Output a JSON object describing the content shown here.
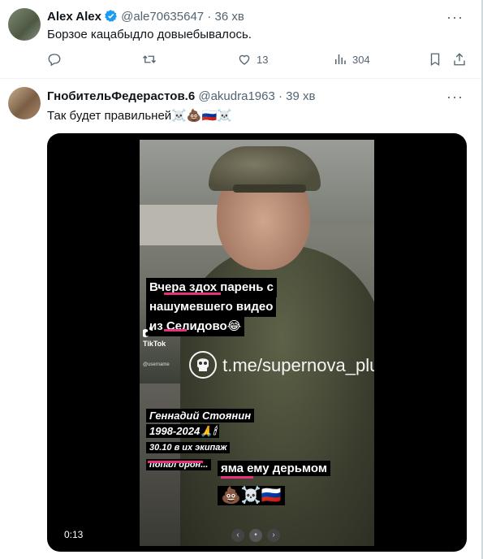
{
  "tweets": [
    {
      "author": "Alex Alex",
      "verified": true,
      "handle": "@ale70635647",
      "time": "36 хв",
      "text": "Борзое кацабыдло  довыебывалось.",
      "actions": {
        "reply": "",
        "retweet": "",
        "likes": "13",
        "views": "304"
      }
    },
    {
      "author": "ГнобительФедерастов.6",
      "handle": "@akudra1963",
      "time": "39 хв",
      "text": "Так будет правильней☠️💩🇷🇺☠️",
      "video": {
        "caption1_line1": "Вчера здох парень с",
        "caption1_line2": "нашумевшего видео",
        "caption1_line3": "из Селидово😂",
        "tiktok_label": "TikTok",
        "tiktok_user": "@username",
        "watermark": "t.me/supernova_plus",
        "caption2_line1": "Геннадий Стоянин",
        "caption2_line2": "1998-2024🙏🕯",
        "caption2_line3": "30.10 в их экипаж",
        "caption2_line4": "попал дрон...",
        "caption3": "яма ему дерьмом",
        "caption4": "💩☠️🇷🇺",
        "timer": "0:13"
      }
    }
  ],
  "colors": {
    "accent": "#1d9bf0",
    "muted": "#536471",
    "highlight": "#e8307c"
  }
}
